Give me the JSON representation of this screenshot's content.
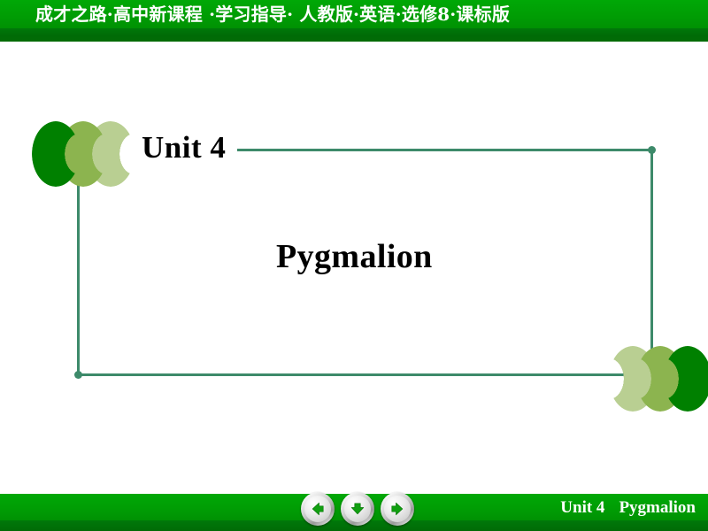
{
  "header": {
    "title": "成才之路·高中新课程 ·学习指导· 人教版·英语·选修8·课标版",
    "bar_color": "#00a000",
    "underbar_color": "#006b06"
  },
  "slide": {
    "unit_label": "Unit 4",
    "lesson_title": "Pygmalion",
    "frame_color": "#3d8a6a",
    "decor": {
      "left_chevrons": [
        "left-chevron-dark",
        "left-chevron-medium",
        "left-chevron-light"
      ],
      "right_chevrons": [
        "right-chevron-light",
        "right-chevron-medium",
        "right-chevron-dark"
      ],
      "chevron_colors": [
        "#008000",
        "#8cb44f",
        "#b9cf92"
      ]
    }
  },
  "footer": {
    "unit_label": "Unit 4",
    "lesson_title": "Pygmalion",
    "bar_color": "#009c04",
    "nav": {
      "prev": {
        "name": "previous-slide-button",
        "icon": "arrow-left-icon",
        "label": "Previous"
      },
      "down": {
        "name": "next-section-button",
        "icon": "arrow-down-icon",
        "label": "Down"
      },
      "next": {
        "name": "next-slide-button",
        "icon": "arrow-right-icon",
        "label": "Next"
      }
    },
    "arrow_color": "#11a011"
  }
}
